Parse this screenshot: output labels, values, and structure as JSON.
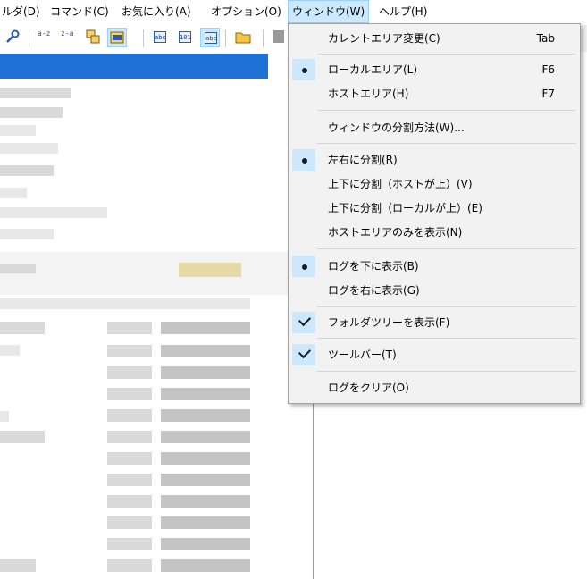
{
  "menubar": {
    "items": [
      {
        "label": "ルダ(D)"
      },
      {
        "label": "コマンド(C)"
      },
      {
        "label": "お気に入り(A)"
      },
      {
        "label": "オプション(O)"
      },
      {
        "label": "ウィンドウ(W)"
      },
      {
        "label": "ヘルプ(H)"
      }
    ]
  },
  "toolbar": {
    "sort_name_asc": "a-z",
    "sort_name_desc": "z-a",
    "mode_ascii": "abc",
    "mode_binary": "101",
    "mode_auto": "abc"
  },
  "window_menu": {
    "items": [
      {
        "label": "カレントエリア変更(C)",
        "shortcut": "Tab",
        "mark": "none"
      },
      {
        "label": "ローカルエリア(L)",
        "shortcut": "F6",
        "mark": "bullet"
      },
      {
        "label": "ホストエリア(H)",
        "shortcut": "F7",
        "mark": "none"
      },
      {
        "label": "ウィンドウの分割方法(W)...",
        "shortcut": "",
        "mark": "none"
      },
      {
        "label": "左右に分割(R)",
        "shortcut": "",
        "mark": "bullet"
      },
      {
        "label": "上下に分割（ホストが上）(V)",
        "shortcut": "",
        "mark": "none"
      },
      {
        "label": "上下に分割（ローカルが上）(E)",
        "shortcut": "",
        "mark": "none"
      },
      {
        "label": "ホストエリアのみを表示(N)",
        "shortcut": "",
        "mark": "none"
      },
      {
        "label": "ログを下に表示(B)",
        "shortcut": "",
        "mark": "bullet"
      },
      {
        "label": "ログを右に表示(G)",
        "shortcut": "",
        "mark": "none"
      },
      {
        "label": "フォルダツリーを表示(F)",
        "shortcut": "",
        "mark": "check"
      },
      {
        "label": "ツールバー(T)",
        "shortcut": "",
        "mark": "check"
      },
      {
        "label": "ログをクリア(O)",
        "shortcut": "",
        "mark": "none"
      }
    ]
  },
  "colors": {
    "menu_highlight": "#cce8ff",
    "selection": "#1e72d6"
  }
}
